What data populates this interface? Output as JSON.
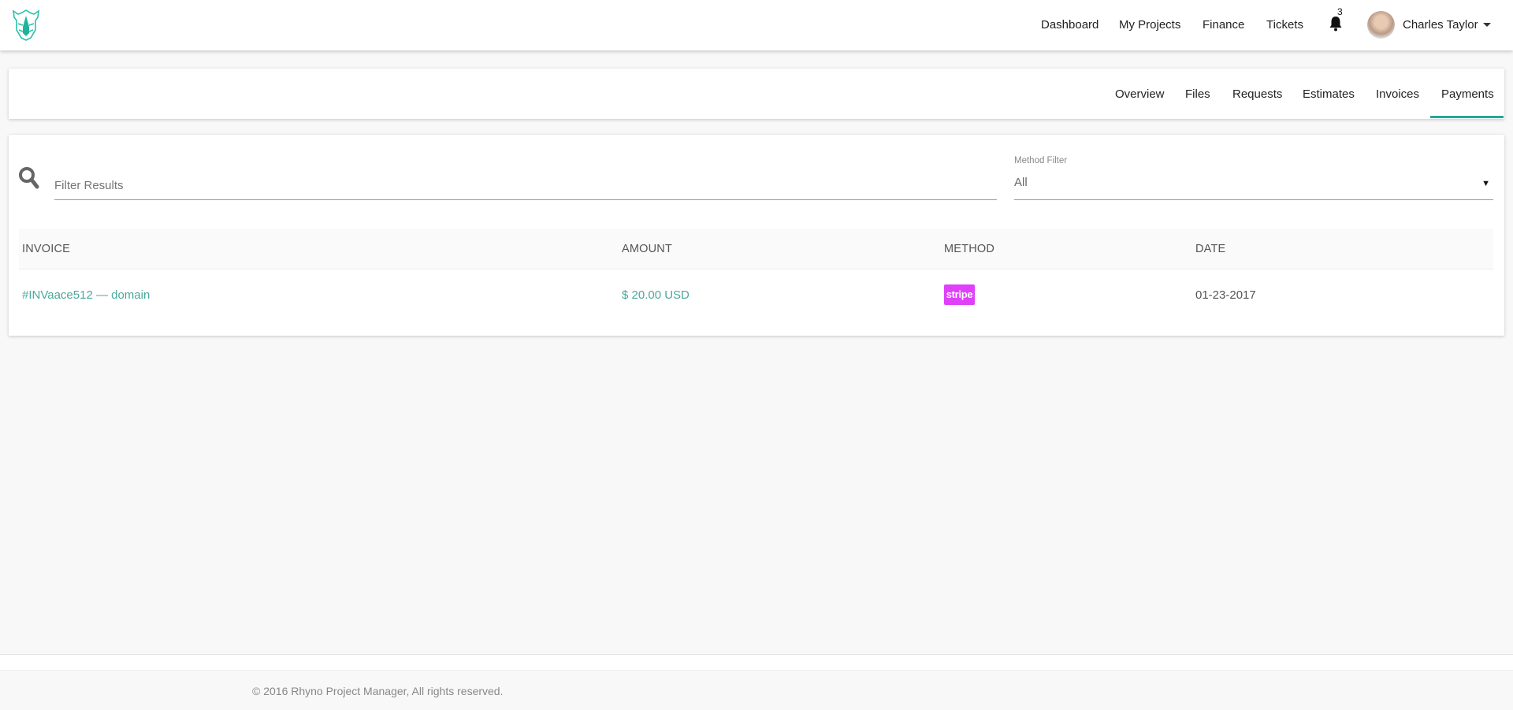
{
  "header": {
    "nav": [
      "Dashboard",
      "My Projects",
      "Finance",
      "Tickets"
    ],
    "notifications_count": "3",
    "user_name": "Charles Taylor"
  },
  "tabs": [
    "Overview",
    "Files",
    "Requests",
    "Estimates",
    "Invoices",
    "Payments"
  ],
  "active_tab": "Payments",
  "filters": {
    "search_placeholder": "Filter Results",
    "method_label": "Method Filter",
    "method_value": "All"
  },
  "table": {
    "columns": [
      "INVOICE",
      "AMOUNT",
      "METHOD",
      "DATE"
    ],
    "rows": [
      {
        "invoice": "#INVaace512 — domain",
        "amount": "$ 20.00 USD",
        "method": "stripe",
        "date": "01-23-2017"
      }
    ]
  },
  "footer": {
    "copyright": "© 2016 Rhyno Project Manager, All rights reserved."
  },
  "colors": {
    "accent": "#26a69a",
    "link": "#4aa89c",
    "stripe": "#e040fb"
  }
}
